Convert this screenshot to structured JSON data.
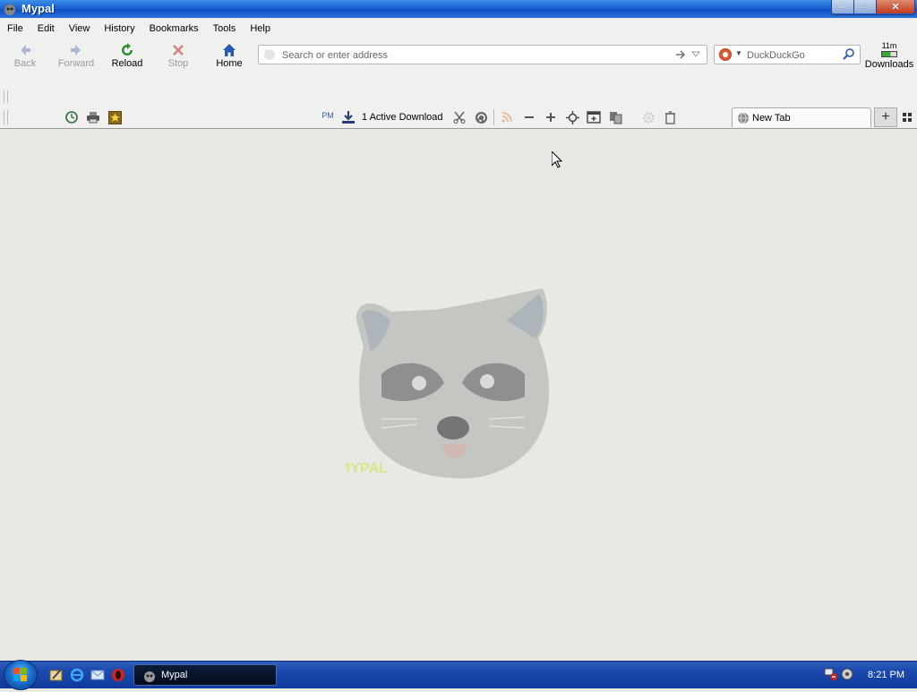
{
  "window": {
    "title": "Mypal",
    "controls": {
      "minimize": "–",
      "maximize": "▫",
      "close": "✕"
    }
  },
  "menu": [
    "File",
    "Edit",
    "View",
    "History",
    "Bookmarks",
    "Tools",
    "Help"
  ],
  "nav": {
    "back": "Back",
    "forward": "Forward",
    "reload": "Reload",
    "stop": "Stop",
    "home": "Home"
  },
  "address": {
    "placeholder": "Search or enter address"
  },
  "search": {
    "placeholder": "DuckDuckGo"
  },
  "downloads": {
    "time": "11m",
    "label": "Downloads",
    "progress": 0.6
  },
  "addon_bar": {
    "pm_label": "PM",
    "active_download": "1 Active Download"
  },
  "tabs": [
    {
      "title": "New Tab"
    }
  ],
  "taskbar": {
    "app_label": "Mypal",
    "clock": "8:21 PM"
  },
  "colors": {
    "accent": "#1b63d6",
    "content_bg": "#e8e8e4",
    "mascot_text": "#d8e36a"
  },
  "icons": {
    "back": "arrow-left-icon",
    "forward": "arrow-right-icon",
    "reload": "reload-icon",
    "stop": "stop-x-icon",
    "home": "home-icon"
  }
}
